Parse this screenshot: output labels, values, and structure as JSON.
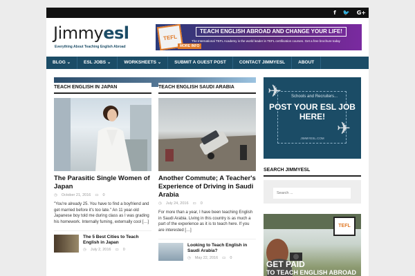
{
  "topbar": {
    "social": [
      {
        "label": "f",
        "icon": "facebook-icon"
      },
      {
        "label": "🐦",
        "icon": "twitter-icon"
      },
      {
        "label": "G+",
        "icon": "googleplus-icon"
      }
    ]
  },
  "header": {
    "logo_plain": "Jimmy",
    "logo_bold": "esl",
    "tagline": "Everything About Teaching English Abroad",
    "banner": {
      "badge": "TEFL",
      "title": "TEACH ENGLISH ABROAD AND CHANGE YOUR LIFE!",
      "sub": "The International TEFL Academy is the world leader in TEFL certification courses. Get a free brochure today",
      "button": "MORE INFO"
    }
  },
  "nav": [
    "BLOG ⌄",
    "ESL JOBS ⌄",
    "WORKSHEETS ⌄",
    "SUBMIT A GUEST POST",
    "CONTACT JIMMYESL",
    "ABOUT"
  ],
  "col_a": {
    "heading": "TEACH ENGLISH IN JAPAN",
    "title": "The Parasitic Single Women of Japan",
    "date": "October 21, 2016",
    "comments": "0",
    "excerpt": "\"You're already 25. You have to find a boyfriend and get married before it's too late.\" An 11 year-old Japanese boy told me during class as I was grading his homework. Internally fuming, externally cool […]",
    "small": {
      "title": "The 5 Best Cities to Teach English in Japan",
      "date": "July 2, 2016",
      "comments": "0"
    }
  },
  "col_b": {
    "heading": "TEACH ENGLISH SAUDI ARABIA",
    "title": "Another Commute; A Teacher's Experience of Driving in Saudi Arabia",
    "date": "July 24, 2016",
    "comments": "0",
    "excerpt": "For more than a year, I have been teaching English in Saudi Arabia. Living in this country is as much a part of the experience as it is to teach here. If you are interested […]",
    "small": {
      "title": "Looking to Teach English in Saudi Arabia?",
      "date": "May 22, 2016",
      "comments": "0"
    }
  },
  "sidebar": {
    "ad_small": "Schools and Recruiters...",
    "ad_big": "POST YOUR ESL JOB HERE!",
    "ad_site": "JIMMYESL.COM",
    "search_heading": "SEARCH JIMMYESL",
    "search_placeholder": "Search ...",
    "paid_badge": "TEFL",
    "paid_line1": "GET PAID",
    "paid_line2": "TO TEACH ENGLISH ABROAD"
  }
}
